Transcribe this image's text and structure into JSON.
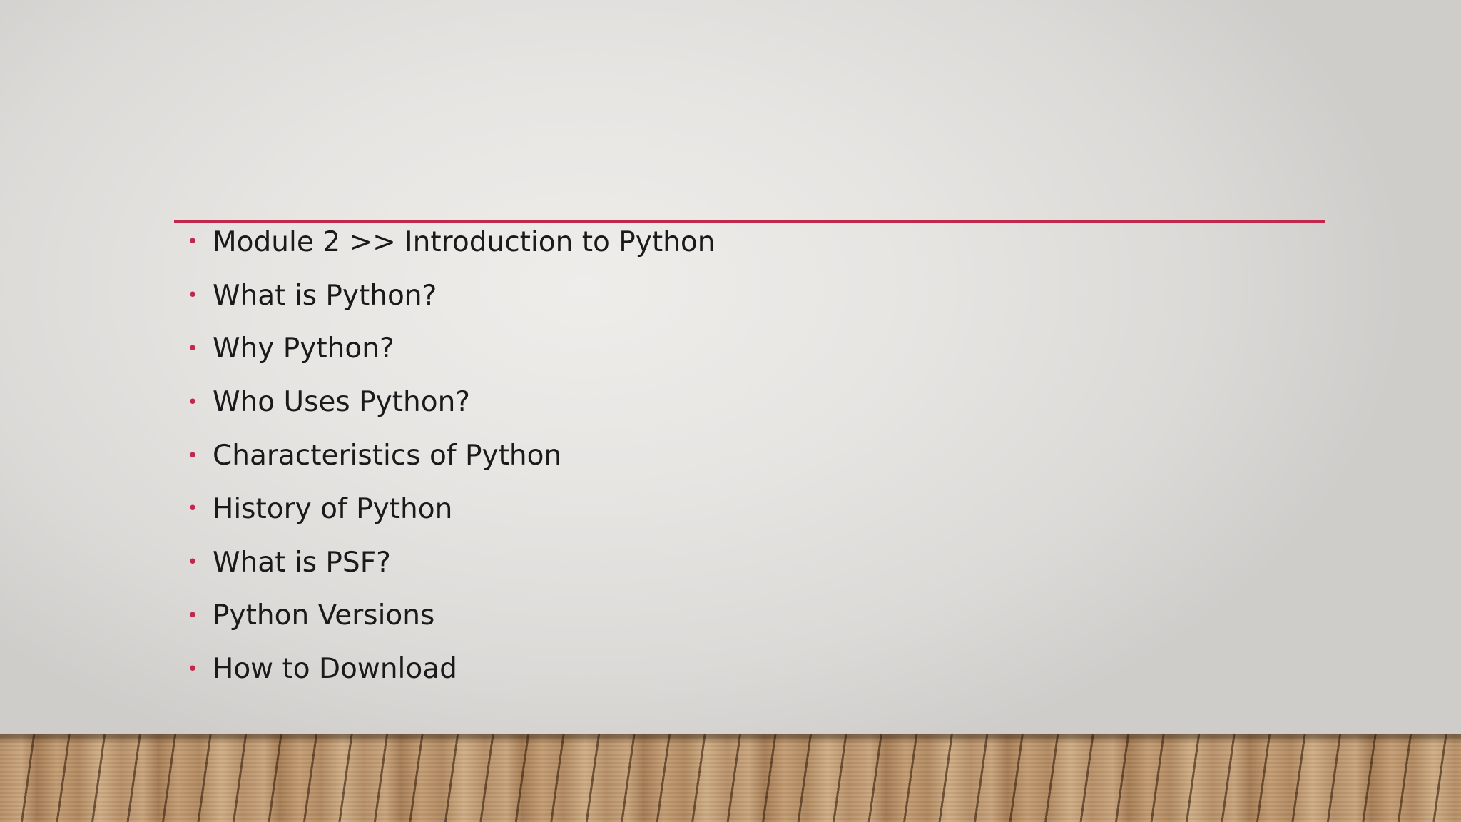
{
  "slide": {
    "accent_color": "#c3274b",
    "bullet_glyph": "•",
    "items": [
      "Module 2 >> Introduction to Python",
      "What is Python?",
      "Why Python?",
      "Who Uses Python?",
      "Characteristics of Python",
      "History of Python",
      "What is PSF?",
      "Python Versions",
      "How to Download"
    ]
  }
}
